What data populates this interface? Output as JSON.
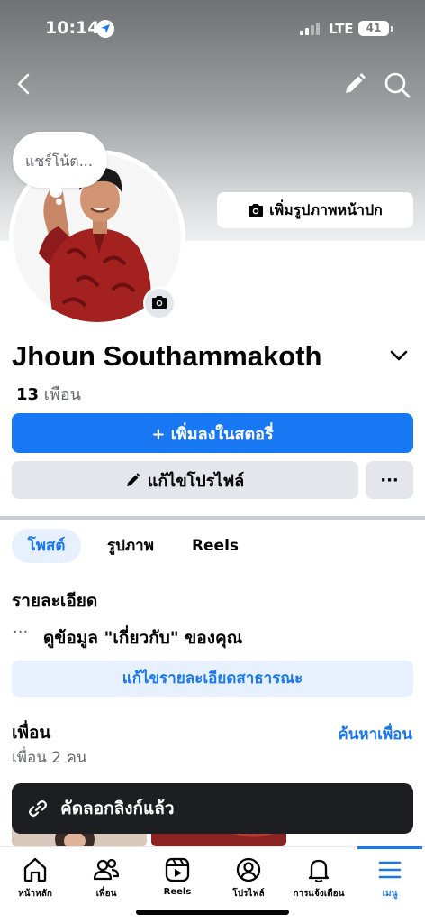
{
  "status_bar": {
    "time": "10:14",
    "network": "LTE",
    "battery": "41"
  },
  "cover": {
    "add_cover_label": "เพิ่มรูปภาพหน้าปก"
  },
  "note": {
    "placeholder": "แชร์โน้ต..."
  },
  "profile": {
    "name": "Jhoun Southammakoth",
    "friends_count": "13",
    "friends_word": "เพือน"
  },
  "actions": {
    "add_story": "+ เพิ่มลงในสตอรี่",
    "edit_profile": "แก้ไขโปรไฟล์",
    "more": "···"
  },
  "tabs": [
    {
      "label": "โพสต์",
      "active": true
    },
    {
      "label": "รูปภาพ",
      "active": false
    },
    {
      "label": "Reels",
      "active": false
    }
  ],
  "details": {
    "title": "รายละเอียด",
    "dots": "···",
    "about_link": "ดูข้อมูล \"เกี่ยวกับ\" ของคุณ",
    "edit_public_details": "แก้ไขรายละเอียดสาธารณะ"
  },
  "friends": {
    "title": "เพื่อน",
    "find_friends": "ค้นหาเพื่อน",
    "count_text": "เพื่อน 2 คน"
  },
  "toast": {
    "message": "คัดลอกลิงก์แล้ว"
  },
  "bottom_nav": [
    {
      "label": "หน้าหลัก",
      "icon": "home-icon"
    },
    {
      "label": "เพื่อน",
      "icon": "friends-icon"
    },
    {
      "label": "Reels",
      "icon": "reels-icon"
    },
    {
      "label": "โปรไฟล์",
      "icon": "profile-icon"
    },
    {
      "label": "การแจ้งเตือน",
      "icon": "bell-icon"
    },
    {
      "label": "เมนู",
      "icon": "menu-icon",
      "active": true
    }
  ],
  "colors": {
    "accent": "#1877f2",
    "secondary_bg": "#e4e6eb",
    "accent_tint": "#e7f0fd",
    "toast_bg": "#1c1e21"
  }
}
